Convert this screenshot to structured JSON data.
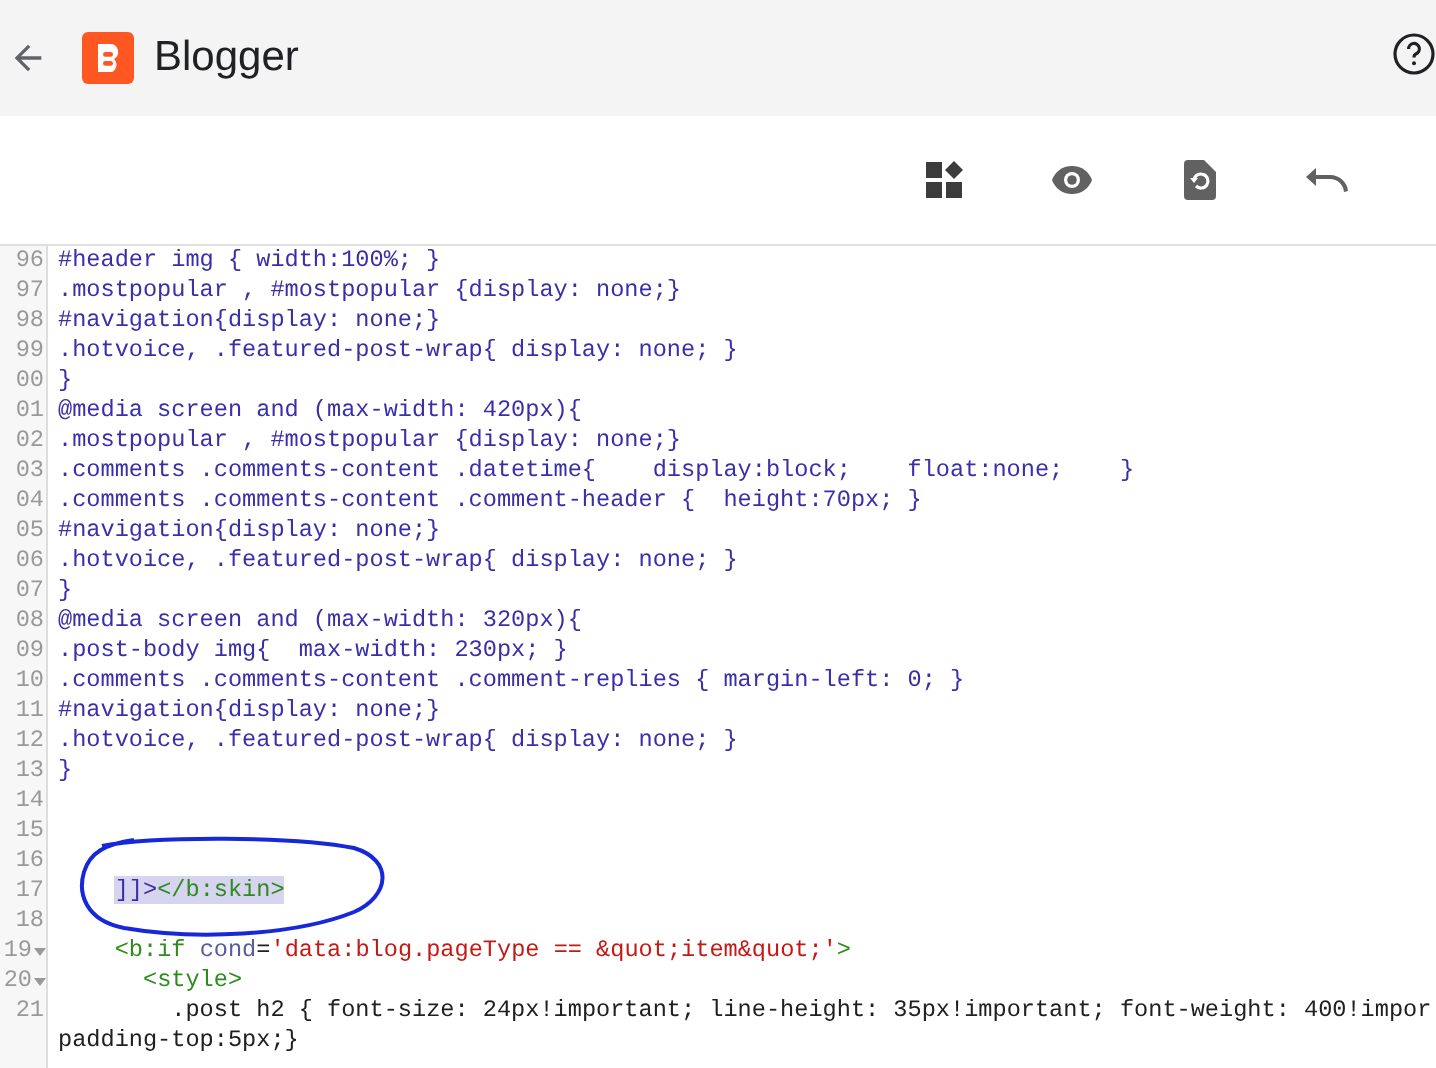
{
  "app_bar": {
    "title": "Blogger"
  },
  "toolbar": {
    "buttons": [
      {
        "kind": "layout"
      },
      {
        "kind": "preview"
      },
      {
        "kind": "restore"
      },
      {
        "kind": "undo"
      }
    ]
  },
  "editor": {
    "lines": [
      {
        "number": "96",
        "fold": false,
        "selected": false,
        "segments": [
          {
            "kind": "css",
            "text": "#header img { width:100%; }"
          }
        ]
      },
      {
        "number": "97",
        "fold": false,
        "selected": false,
        "segments": [
          {
            "kind": "css",
            "text": ".mostpopular , #mostpopular {display: none;}"
          }
        ]
      },
      {
        "number": "98",
        "fold": false,
        "selected": false,
        "segments": [
          {
            "kind": "css",
            "text": "#navigation{display: none;}"
          }
        ]
      },
      {
        "number": "99",
        "fold": false,
        "selected": false,
        "segments": [
          {
            "kind": "css",
            "text": ".hotvoice, .featured-post-wrap{ display: none; }"
          }
        ]
      },
      {
        "number": "00",
        "fold": false,
        "selected": false,
        "segments": [
          {
            "kind": "css",
            "text": "}"
          }
        ]
      },
      {
        "number": "01",
        "fold": false,
        "selected": false,
        "segments": [
          {
            "kind": "css",
            "text": "@media screen and (max-width: 420px){"
          }
        ]
      },
      {
        "number": "02",
        "fold": false,
        "selected": false,
        "segments": [
          {
            "kind": "css",
            "text": ".mostpopular , #mostpopular {display: none;}"
          }
        ]
      },
      {
        "number": "03",
        "fold": false,
        "selected": false,
        "segments": [
          {
            "kind": "css",
            "text": ".comments .comments-content .datetime{    display:block;    float:none;    }"
          }
        ]
      },
      {
        "number": "04",
        "fold": false,
        "selected": false,
        "segments": [
          {
            "kind": "css",
            "text": ".comments .comments-content .comment-header {  height:70px; }"
          }
        ]
      },
      {
        "number": "05",
        "fold": false,
        "selected": false,
        "segments": [
          {
            "kind": "css",
            "text": "#navigation{display: none;}"
          }
        ]
      },
      {
        "number": "06",
        "fold": false,
        "selected": false,
        "segments": [
          {
            "kind": "css",
            "text": ".hotvoice, .featured-post-wrap{ display: none; }"
          }
        ]
      },
      {
        "number": "07",
        "fold": false,
        "selected": false,
        "segments": [
          {
            "kind": "css",
            "text": "}"
          }
        ]
      },
      {
        "number": "08",
        "fold": false,
        "selected": false,
        "segments": [
          {
            "kind": "css",
            "text": "@media screen and (max-width: 320px){"
          }
        ]
      },
      {
        "number": "09",
        "fold": false,
        "selected": false,
        "segments": [
          {
            "kind": "css",
            "text": ".post-body img{  max-width: 230px; }"
          }
        ]
      },
      {
        "number": "10",
        "fold": false,
        "selected": false,
        "segments": [
          {
            "kind": "css",
            "text": ".comments .comments-content .comment-replies { margin-left: 0; }"
          }
        ]
      },
      {
        "number": "11",
        "fold": false,
        "selected": false,
        "segments": [
          {
            "kind": "css",
            "text": "#navigation{display: none;}"
          }
        ]
      },
      {
        "number": "12",
        "fold": false,
        "selected": false,
        "segments": [
          {
            "kind": "css",
            "text": ".hotvoice, .featured-post-wrap{ display: none; }"
          }
        ]
      },
      {
        "number": "13",
        "fold": false,
        "selected": false,
        "segments": [
          {
            "kind": "css",
            "text": "}"
          }
        ]
      },
      {
        "number": "14",
        "fold": false,
        "selected": false
      },
      {
        "number": "15",
        "fold": false,
        "selected": false
      },
      {
        "number": "16",
        "fold": false,
        "selected": false
      },
      {
        "number": "17",
        "fold": false,
        "selected": true,
        "segments": [
          {
            "kind": "css",
            "text": "    ]]>"
          },
          {
            "kind": "tag",
            "text": "</b:skin>"
          }
        ]
      },
      {
        "number": "18",
        "fold": false,
        "selected": false
      },
      {
        "number": "19",
        "fold": true,
        "selected": false,
        "segments": [
          {
            "kind": "tag",
            "text": "    <b:if "
          },
          {
            "kind": "attr",
            "text": "cond"
          },
          {
            "kind": "plain",
            "text": "="
          },
          {
            "kind": "string",
            "text": "'data:blog.pageType == &quot;item&quot;'"
          },
          {
            "kind": "tag",
            "text": ">"
          }
        ]
      },
      {
        "number": "20",
        "fold": true,
        "selected": false,
        "segments": [
          {
            "kind": "tag",
            "text": "      <style>"
          }
        ]
      },
      {
        "number": "21",
        "fold": false,
        "selected": false,
        "segments": [
          {
            "kind": "plain",
            "text": "        .post h2 { font-size: 24px!important; line-height: 35px!important; font-weight: 400!impor"
          }
        ],
        "continuation": "padding-top:5px;}"
      }
    ]
  }
}
